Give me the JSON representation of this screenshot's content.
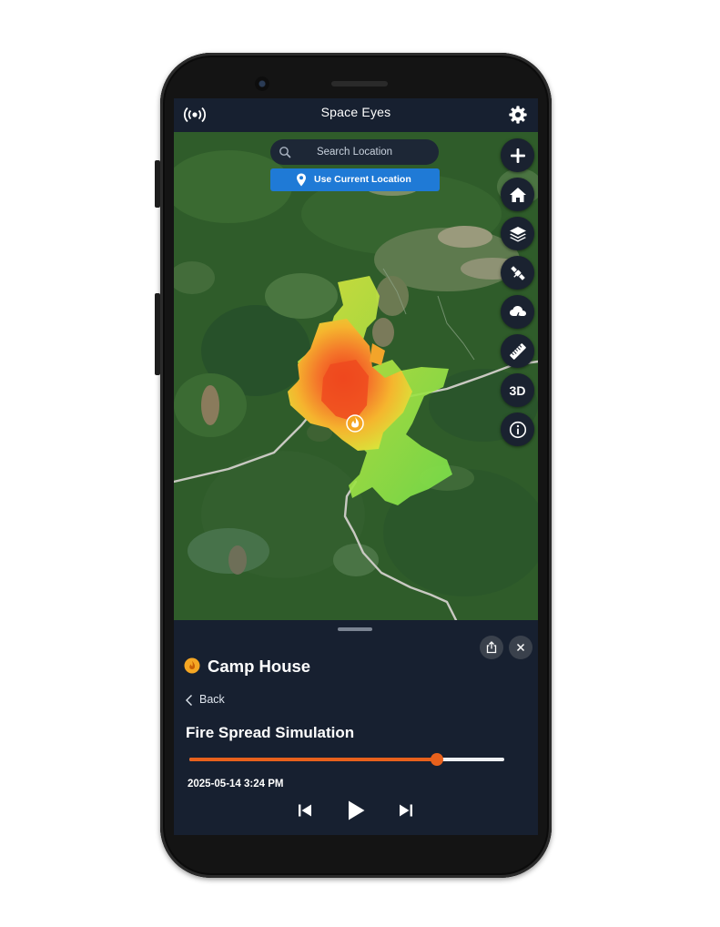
{
  "app": {
    "title": "Space Eyes"
  },
  "search": {
    "placeholder": "Search Location"
  },
  "location_button": {
    "label": "Use Current Location"
  },
  "map_tools": [
    {
      "name": "zoom-in-button",
      "icon": "plus-icon"
    },
    {
      "name": "home-button",
      "icon": "home-icon"
    },
    {
      "name": "layers-button",
      "icon": "layers-icon"
    },
    {
      "name": "satellite-button",
      "icon": "satellite-icon"
    },
    {
      "name": "weather-button",
      "icon": "storm-cloud-icon"
    },
    {
      "name": "measure-button",
      "icon": "ruler-icon"
    },
    {
      "name": "3d-toggle-button",
      "label": "3D"
    },
    {
      "name": "info-button",
      "icon": "info-icon"
    }
  ],
  "panel": {
    "place_name": "Camp House",
    "back_label": "Back",
    "simulation_title": "Fire Spread Simulation",
    "progress": 0.785,
    "timestamp": "2025-05-14 3:24 PM"
  },
  "colors": {
    "accent_orange": "#e8611c",
    "button_blue": "#1f7ad6",
    "panel_bg": "#172030",
    "fire_marker": "#f5a623"
  }
}
